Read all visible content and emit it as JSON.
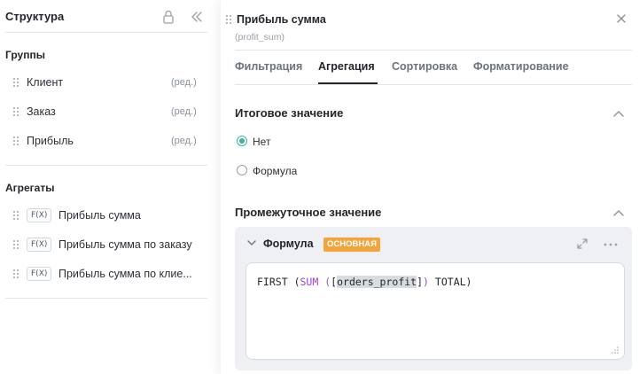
{
  "left_panel": {
    "title": "Структура",
    "groups": {
      "title": "Группы",
      "items": [
        {
          "label": "Клиент",
          "edit": "(ред.)"
        },
        {
          "label": "Заказ",
          "edit": "(ред.)"
        },
        {
          "label": "Прибыль",
          "edit": "(ред.)"
        }
      ]
    },
    "aggregates": {
      "title": "Агрегаты",
      "items": [
        {
          "badge": "F(X)",
          "label": "Прибыль сумма"
        },
        {
          "badge": "F(X)",
          "label": "Прибыль сумма по заказу"
        },
        {
          "badge": "F(X)",
          "label": "Прибыль сумма по клие..."
        }
      ]
    }
  },
  "right_panel": {
    "title": "Прибыль сумма",
    "subtitle": "(profit_sum)",
    "tabs": [
      {
        "label": "Фильтрация",
        "active": false
      },
      {
        "label": "Агрегация",
        "active": true
      },
      {
        "label": "Сортировка",
        "active": false
      },
      {
        "label": "Форматирование",
        "active": false
      }
    ],
    "total_value": {
      "title": "Итоговое значение",
      "options": [
        {
          "label": "Нет",
          "checked": true
        },
        {
          "label": "Формула",
          "checked": false
        }
      ]
    },
    "intermediate_value": {
      "title": "Промежуточное значение",
      "formula": {
        "title": "Формула",
        "badge": "ОСНОВНАЯ",
        "code": {
          "func": "FIRST",
          "open1": "(",
          "agg": "SUM",
          "open2": "(",
          "open3": "[",
          "field": "orders_profit",
          "close3": "]",
          "close2": ")",
          "keyword": "TOTAL",
          "close1": ")"
        }
      }
    }
  },
  "colors": {
    "accent_teal": "#3fb0a8",
    "badge_orange": "#f2a53d",
    "agg_purple": "#a23ad8"
  }
}
